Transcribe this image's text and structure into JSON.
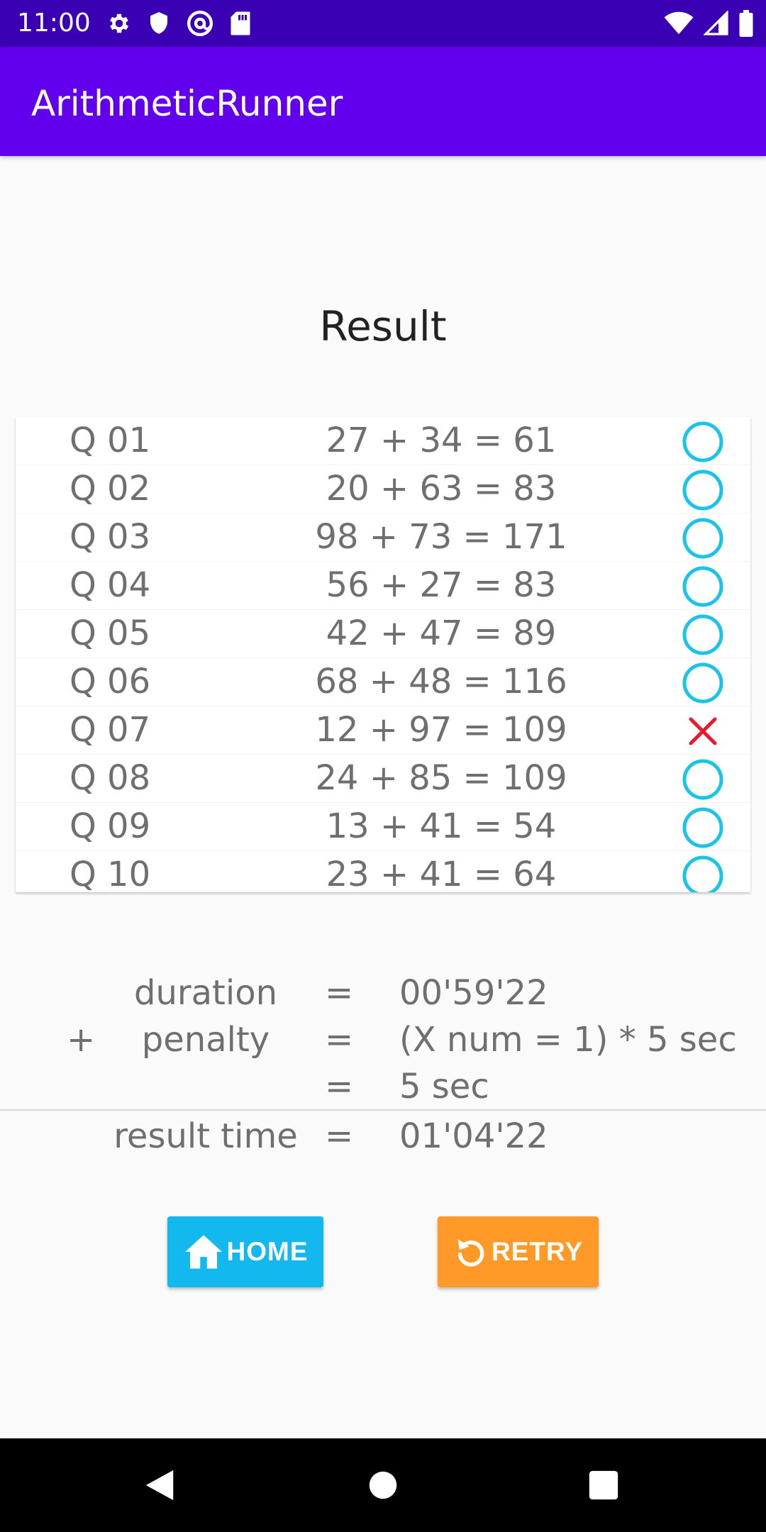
{
  "status_bar": {
    "time": "11:00",
    "left_icons": [
      "gear-icon",
      "shield-icon",
      "at-sign-icon",
      "sd-card-icon"
    ],
    "right_icons": [
      "wifi-icon",
      "cellular-signal-icon",
      "battery-icon"
    ]
  },
  "app_bar": {
    "title": "ArithmeticRunner"
  },
  "heading": "Result",
  "questions": [
    {
      "label": "Q 01",
      "equation": "27 + 34 = 61",
      "correct": true
    },
    {
      "label": "Q 02",
      "equation": "20 + 63 = 83",
      "correct": true
    },
    {
      "label": "Q 03",
      "equation": "98 + 73 = 171",
      "correct": true
    },
    {
      "label": "Q 04",
      "equation": "56 + 27 = 83",
      "correct": true
    },
    {
      "label": "Q 05",
      "equation": "42 + 47 = 89",
      "correct": true
    },
    {
      "label": "Q 06",
      "equation": "68 + 48 = 116",
      "correct": true
    },
    {
      "label": "Q 07",
      "equation": "12 + 97 = 109",
      "correct": false
    },
    {
      "label": "Q 08",
      "equation": "24 + 85 = 109",
      "correct": true
    },
    {
      "label": "Q 09",
      "equation": "13 + 41 = 54",
      "correct": true
    },
    {
      "label": "Q 10",
      "equation": "23 + 41 = 64",
      "correct": true
    }
  ],
  "summary": {
    "duration": {
      "op": "",
      "label": "duration",
      "eq": "=",
      "value": "00'59'22"
    },
    "penalty": {
      "op": "+",
      "label": "penalty",
      "eq": "=",
      "value": "(X num = 1) * 5 sec"
    },
    "penalty_total": {
      "op": "",
      "label": "",
      "eq": "=",
      "value": "5 sec"
    },
    "result_time": {
      "op": "",
      "label": "result time",
      "eq": "=",
      "value": "01'04'22"
    }
  },
  "buttons": {
    "home": {
      "label": "HOME",
      "icon": "home-icon"
    },
    "retry": {
      "label": "RETRY",
      "icon": "retry-icon"
    }
  },
  "nav_bar": {
    "icons": [
      "back-triangle-icon",
      "home-circle-icon",
      "recents-square-icon"
    ]
  },
  "colors": {
    "status_bar": "#3a00b3",
    "app_bar": "#6200ee",
    "correct_mark": "#1cc3e8",
    "wrong_mark": "#e8192c",
    "home_button": "#12b8ee",
    "retry_button": "#ff9a28"
  }
}
